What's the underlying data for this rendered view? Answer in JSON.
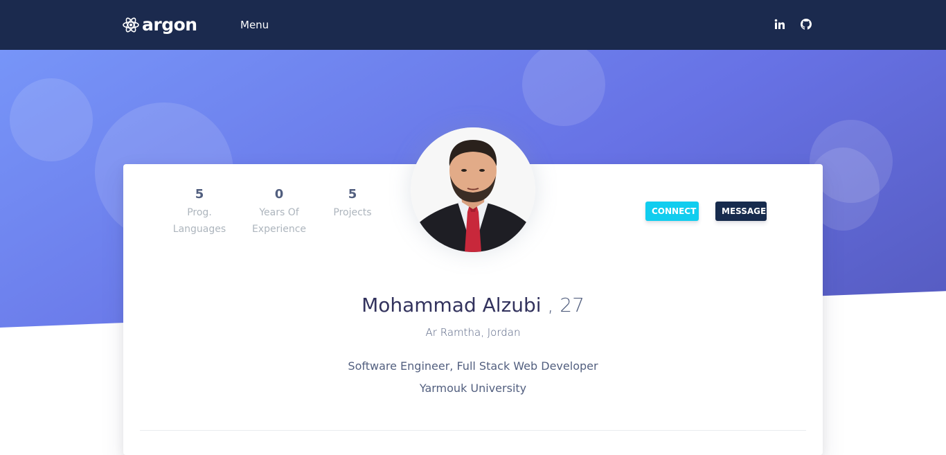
{
  "navbar": {
    "brand": "argon",
    "menu_label": "Menu",
    "icons": [
      "linkedin-icon",
      "github-icon"
    ]
  },
  "profile": {
    "stats": [
      {
        "value": "5",
        "label": "Prog. Languages"
      },
      {
        "value": "0",
        "label": "Years Of Experience"
      },
      {
        "value": "5",
        "label": "Projects"
      }
    ],
    "buttons": {
      "connect": "CONNECT",
      "message": "MESSAGE"
    },
    "name": "Mohammad Alzubi",
    "age": " , 27",
    "location": "Ar Ramtha, Jordan",
    "job": "Software Engineer, Full Stack Web Developer",
    "education": "Yarmouk University"
  },
  "colors": {
    "navbar_bg": "#1b2a4e",
    "hero_start": "#7795f8",
    "hero_end": "#555abf",
    "connect_btn": "#11cdef",
    "message_btn": "#172b4d"
  }
}
